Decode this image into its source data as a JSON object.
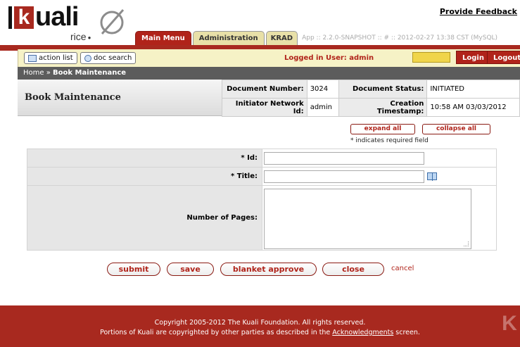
{
  "header": {
    "logo_word": "uali",
    "logo_k": "k",
    "logo_sub": "rice",
    "feedback_link": "Provide Feedback",
    "tabs": [
      {
        "label": "Main Menu"
      },
      {
        "label": "Administration"
      },
      {
        "label": "KRAD"
      }
    ],
    "build_info": "App :: 2.2.0-SNAPSHOT :: # :: 2012-02-27 13:38 CST (MySQL)"
  },
  "toolbar": {
    "action_list": "action list",
    "doc_search": "doc search",
    "logged_in": "Logged in User: admin",
    "login_value": "",
    "login_label": "Login",
    "logout_label": "Logout"
  },
  "breadcrumb": {
    "home": "Home",
    "separator": "»",
    "current": "Book Maintenance"
  },
  "document": {
    "title": "Book Maintenance",
    "number_label": "Document Number:",
    "number_value": "3024",
    "status_label": "Document Status:",
    "status_value": "INITIATED",
    "initiator_label": "Initiator Network Id:",
    "initiator_value": "admin",
    "timestamp_label": "Creation Timestamp:",
    "timestamp_value": "10:58 AM 03/03/2012"
  },
  "controls": {
    "expand_all": "expand all",
    "collapse_all": "collapse all",
    "required_note": "* indicates required field"
  },
  "form": {
    "id_label": "* Id:",
    "id_value": "",
    "title_label": "* Title:",
    "title_value": "",
    "pages_label": "Number of Pages:",
    "pages_value": ""
  },
  "actions": {
    "submit": "submit",
    "save": "save",
    "blanket_approve": "blanket approve",
    "close": "close",
    "cancel": "cancel"
  },
  "footer": {
    "line1": "Copyright 2005-2012 The Kuali Foundation. All rights reserved.",
    "line2_pre": "Portions of Kuali are copyrighted by other parties as described in the ",
    "line2_link": "Acknowledgments",
    "line2_post": " screen.",
    "logo_k": "K"
  },
  "colors": {
    "brand_red": "#a8291f",
    "cream": "#f6f2c6",
    "tab_inactive": "#e8e0a8"
  }
}
